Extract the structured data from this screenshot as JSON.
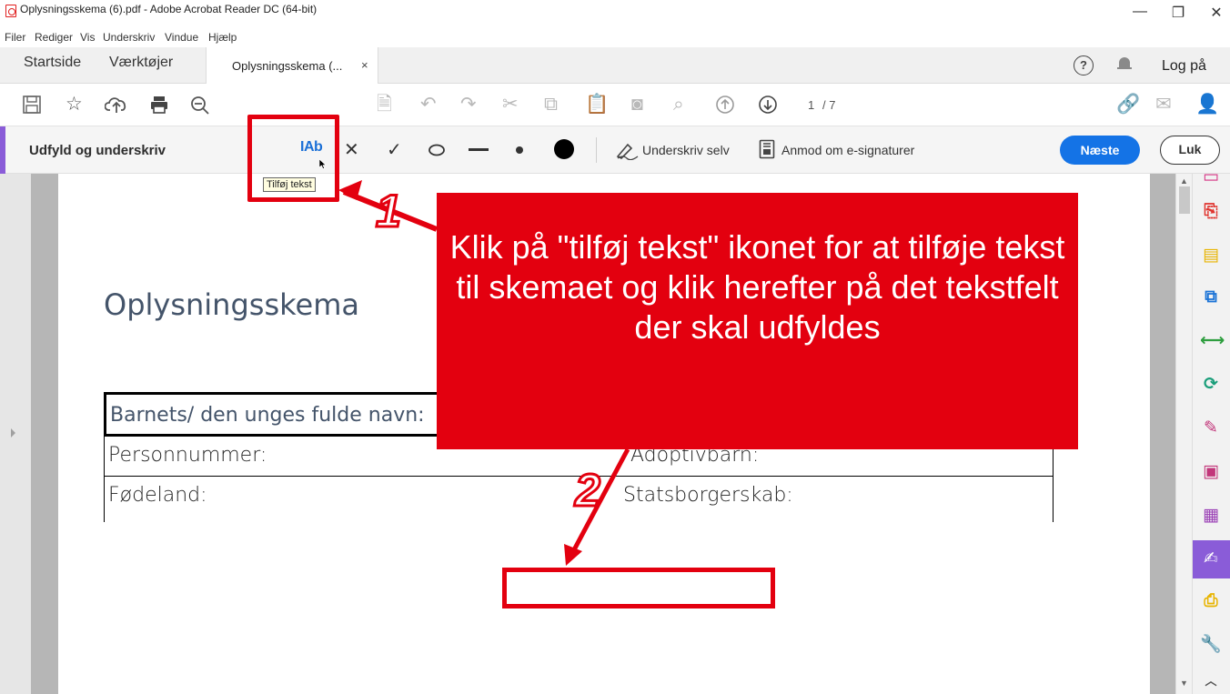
{
  "window": {
    "title": "Oplysningsskema (6).pdf - Adobe Acrobat Reader DC (64-bit)",
    "minimize": "—",
    "restore": "❐",
    "close": "✕"
  },
  "menu": [
    "Filer",
    "Rediger",
    "Vis",
    "Underskriv",
    "Vindue",
    "Hjælp"
  ],
  "tabs": {
    "home": "Startside",
    "tools": "Værktøjer",
    "active": "Oplysningsskema (...",
    "active_close": "×"
  },
  "header_right": {
    "help": "?",
    "login": "Log på"
  },
  "toolbar": {
    "page_current": "1",
    "page_total": "/ 7"
  },
  "fillsign": {
    "title": "Udfyld og underskriv",
    "add_text_icon": "IAb",
    "tooltip": "Tilføj tekst",
    "sign_self": "Underskriv selv",
    "request_esign": "Anmod om e-signaturer",
    "next": "Næste",
    "close": "Luk"
  },
  "document": {
    "title": "Oplysningsskema",
    "fields": {
      "name": "Barnets/ den unges fulde navn:",
      "cpr": "Personnummer:",
      "adopted": "Adoptivbarn:",
      "birthcountry": "Fødeland:",
      "citizenship": "Statsborgerskab:"
    }
  },
  "annotation": {
    "callout": "Klik på \"tilføj tekst\" ikonet for at tilføje tekst til skemaet og klik herefter på det tekstfelt der skal udfyldes",
    "step1": "1",
    "step2": "2"
  },
  "colors": {
    "accent_purple": "#8a5cd8",
    "primary_blue": "#1473e6",
    "annotation_red": "#e3000f"
  }
}
